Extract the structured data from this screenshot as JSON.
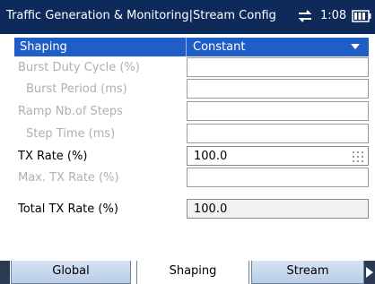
{
  "status_bar": {
    "title": "Traffic Generation  & Monitoring|Stream Config",
    "time": "1:08"
  },
  "form": {
    "header": {
      "label": "Shaping",
      "value": "Constant"
    },
    "rows": [
      {
        "label": "Burst Duty Cycle (%)",
        "value": ""
      },
      {
        "label": "Burst Period (ms)",
        "value": ""
      },
      {
        "label": "Ramp Nb.of Steps",
        "value": ""
      },
      {
        "label": "Step Time (ms)",
        "value": ""
      },
      {
        "label": "TX Rate (%)",
        "value": "100.0"
      },
      {
        "label": "Max. TX Rate (%)",
        "value": ""
      },
      {
        "label": "Total TX Rate (%)",
        "value": "100.0"
      }
    ]
  },
  "tabs": [
    {
      "label": "Global"
    },
    {
      "label": "Shaping"
    },
    {
      "label": "Stream"
    }
  ],
  "colors": {
    "status_bar_bg": "#0e2a5a",
    "selected_row_bg": "#1f5ec8",
    "disabled_text": "#b0b0b0"
  }
}
